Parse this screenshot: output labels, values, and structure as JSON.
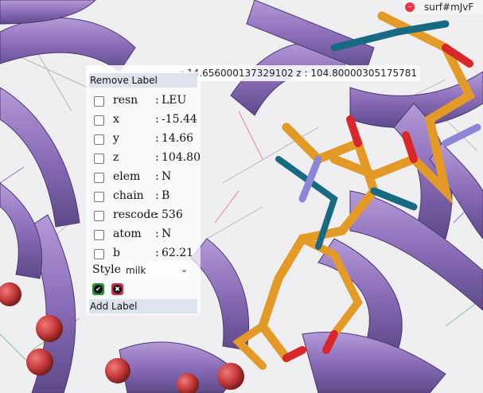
{
  "surface_chip": {
    "label": "surf#mJvF"
  },
  "coord_bar": {
    "text": ": 14.656000137329102 z : 104.80000305175781"
  },
  "panel": {
    "remove_label": "Remove Label",
    "add_label": "Add Label",
    "properties": [
      {
        "key": "resn",
        "value": "LEU",
        "checked": false
      },
      {
        "key": "x",
        "value": "-15.44",
        "checked": false
      },
      {
        "key": "y",
        "value": "14.66",
        "checked": false
      },
      {
        "key": "z",
        "value": "104.80",
        "checked": false
      },
      {
        "key": "elem",
        "value": "N",
        "checked": false
      },
      {
        "key": "chain",
        "value": "B",
        "checked": false
      },
      {
        "key": "rescode",
        "value": "536",
        "checked": false
      },
      {
        "key": "atom",
        "value": "N",
        "checked": false
      },
      {
        "key": "b",
        "value": "62.21",
        "checked": false
      }
    ],
    "separator": ":",
    "style": {
      "label": "Style",
      "selected": "milk"
    },
    "confirm_icon": "check-icon",
    "cancel_icon": "x-icon"
  },
  "colors": {
    "ribbon": "#8a6db8",
    "ribbon_dark": "#5d4a8a",
    "stick_orange": "#e39a27",
    "oxygen": "#d8262a",
    "nitrogen": "#8b86d6",
    "teal": "#186a82",
    "confirm": "#2f8a3a",
    "cancel": "#c7344a"
  }
}
